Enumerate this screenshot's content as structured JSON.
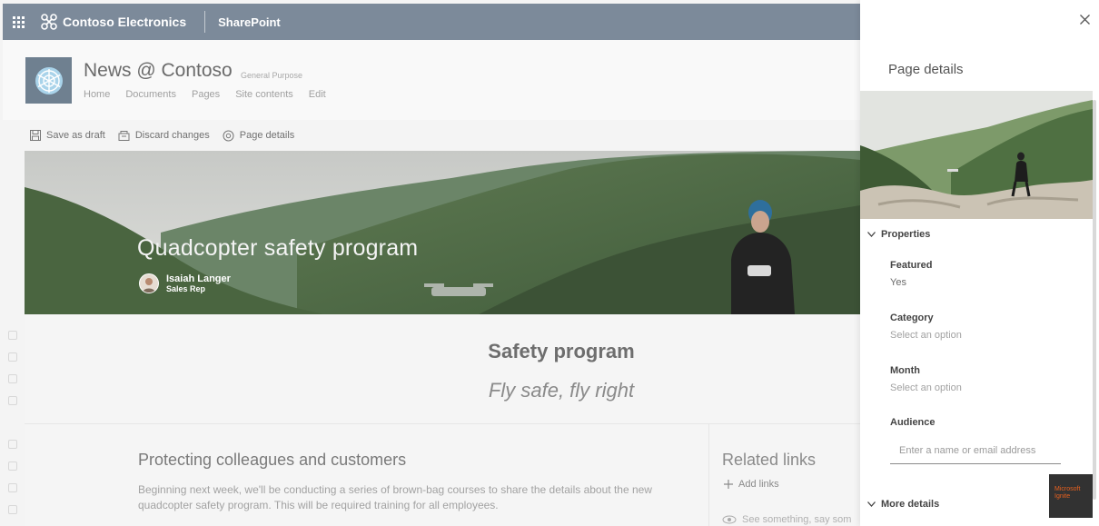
{
  "suite": {
    "brand": "Contoso Electronics",
    "app": "SharePoint"
  },
  "site": {
    "title": "News @ Contoso",
    "description": "General Purpose",
    "nav": [
      "Home",
      "Documents",
      "Pages",
      "Site contents",
      "Edit"
    ]
  },
  "commands": {
    "save_draft": "Save as draft",
    "discard": "Discard changes",
    "page_details": "Page details"
  },
  "hero": {
    "title": "Quadcopter safety program",
    "author_name": "Isaiah Langer",
    "author_role": "Sales Rep"
  },
  "content": {
    "section_title": "Safety program",
    "section_subtitle": "Fly safe, fly right",
    "article_heading": "Protecting colleagues and customers",
    "article_body": "Beginning next week, we'll be conducting a series of brown-bag courses to share the details about the new quadcopter safety program. This will be required training for all employees."
  },
  "related": {
    "title": "Related links",
    "add_links": "Add links",
    "see_something": "See something, say som"
  },
  "panel": {
    "title": "Page details",
    "properties_label": "Properties",
    "featured_label": "Featured",
    "featured_value": "Yes",
    "category_label": "Category",
    "category_value": "Select an option",
    "month_label": "Month",
    "month_value": "Select an option",
    "audience_label": "Audience",
    "audience_placeholder": "Enter a name or email address",
    "more_details_label": "More details"
  },
  "event_logo": {
    "line1": "Microsoft",
    "line2": "Ignite"
  },
  "colors": {
    "suite_bar": "#7c8a9a",
    "accent": "#e8611f",
    "panel_bg": "#ffffff"
  },
  "icons": [
    "waffle-icon",
    "contoso-logo-icon",
    "save-icon",
    "discard-icon",
    "gear-icon",
    "close-icon",
    "chevron-down-icon",
    "plus-icon",
    "eye-icon"
  ]
}
